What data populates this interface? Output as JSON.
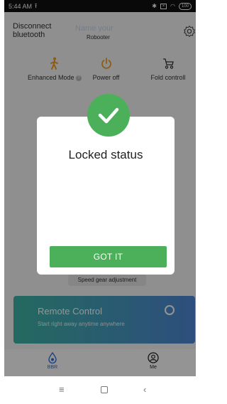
{
  "status_bar": {
    "time": "5:44 AM",
    "battery": "100"
  },
  "header": {
    "disconnect_line1": "Disconnect",
    "disconnect_line2": "bluetooth",
    "name_title": "Name your",
    "name_sub": "Robooter"
  },
  "features": [
    {
      "label": "Enhanced Mode",
      "icon": "walker-icon",
      "color": "#f0a020"
    },
    {
      "label": "Power off",
      "icon": "power-icon",
      "color": "#f0a020"
    },
    {
      "label": "Fold controll",
      "icon": "stroller-icon",
      "color": "#333333"
    }
  ],
  "speed_label": "Speed gear adjustment",
  "remote": {
    "title": "Remote Control",
    "subtitle": "Start right away anytime anywhere"
  },
  "tabs": [
    {
      "label": "BBR",
      "icon": "bbr-icon",
      "active": true
    },
    {
      "label": "Me",
      "icon": "user-icon",
      "active": false
    }
  ],
  "dialog": {
    "title": "Locked status",
    "button": "GOT IT",
    "accent": "#4cb05a"
  },
  "nav": {
    "menu_icon": "menu-icon",
    "home_icon": "home-icon",
    "back_icon": "back-icon"
  }
}
